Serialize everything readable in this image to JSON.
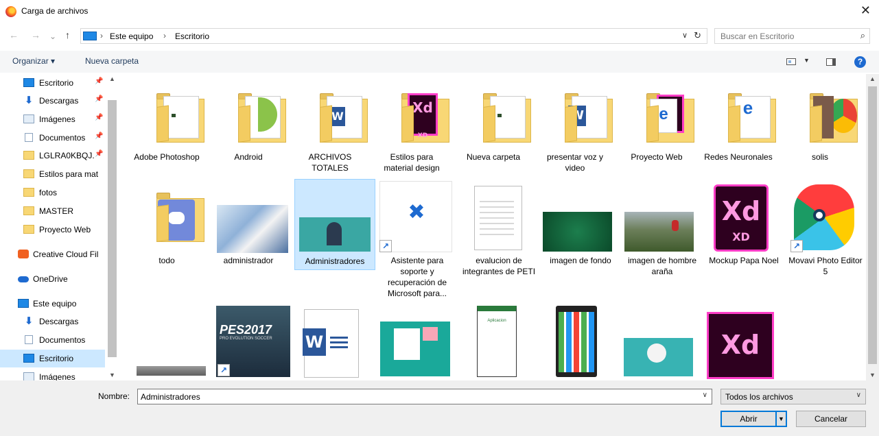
{
  "window": {
    "title": "Carga de archivos",
    "close_glyph": "✕"
  },
  "nav": {
    "back": "←",
    "forward": "→",
    "up": "↑"
  },
  "breadcrumb": {
    "items": [
      "Este equipo",
      "Escritorio"
    ],
    "separator": "›"
  },
  "search": {
    "placeholder": "Buscar en Escritorio"
  },
  "toolbar": {
    "organize_label": "Organizar ▾",
    "new_folder_label": "Nueva carpeta",
    "help_label": "?"
  },
  "sidebar": {
    "items": [
      {
        "label": "Escritorio",
        "icon": "desktop-icon",
        "pinned": true
      },
      {
        "label": "Descargas",
        "icon": "download-icon",
        "pinned": true
      },
      {
        "label": "Imágenes",
        "icon": "pictures-icon",
        "pinned": true
      },
      {
        "label": "Documentos",
        "icon": "documents-icon",
        "pinned": true
      },
      {
        "label": "LGLRA0KBQJ.",
        "icon": "folder-icon",
        "pinned": true
      },
      {
        "label": "Estilos  para mat",
        "icon": "folder-icon",
        "pinned": false
      },
      {
        "label": "fotos",
        "icon": "folder-icon",
        "pinned": false
      },
      {
        "label": "MASTER",
        "icon": "folder-icon",
        "pinned": false
      },
      {
        "label": "Proyecto Web",
        "icon": "folder-icon",
        "pinned": false
      },
      {
        "label": "Creative Cloud Fil",
        "icon": "creative-cloud-icon",
        "pinned": false
      },
      {
        "label": "OneDrive",
        "icon": "onedrive-icon",
        "pinned": false
      },
      {
        "label": "Este equipo",
        "icon": "this-pc-icon",
        "pinned": false
      },
      {
        "label": "Descargas",
        "icon": "download-icon",
        "pinned": false
      },
      {
        "label": "Documentos",
        "icon": "documents-icon",
        "pinned": false
      },
      {
        "label": "Escritorio",
        "icon": "desktop-icon",
        "pinned": false,
        "selected": true
      },
      {
        "label": "Imágenes",
        "icon": "pictures-icon",
        "pinned": false
      }
    ]
  },
  "files": {
    "row1": [
      {
        "label": "Adobe Photoshop",
        "type": "folder"
      },
      {
        "label": "Android",
        "type": "folder"
      },
      {
        "label": "ARCHIVOS TOTALES",
        "type": "folder"
      },
      {
        "label": "Estilos  para material design",
        "type": "folder"
      },
      {
        "label": "Nueva carpeta",
        "type": "folder"
      },
      {
        "label": "presentar voz y video",
        "type": "folder"
      },
      {
        "label": "Proyecto Web",
        "type": "folder"
      },
      {
        "label": "Redes Neuronales",
        "type": "folder"
      },
      {
        "label": "solis",
        "type": "folder"
      }
    ],
    "row2": [
      {
        "label": "todo",
        "type": "folder"
      },
      {
        "label": "administrador",
        "type": "image"
      },
      {
        "label": "Administradores",
        "type": "image",
        "selected": true
      },
      {
        "label": "Asistente para soporte y recuperación de Microsoft para...",
        "type": "shortcut"
      },
      {
        "label": "evalucion de integrantes de PETI",
        "type": "document"
      },
      {
        "label": "imagen de fondo",
        "type": "image"
      },
      {
        "label": "imagen de hombre araña",
        "type": "image"
      },
      {
        "label": "Mockup Papa Noel",
        "type": "xd"
      },
      {
        "label": "Movavi Photo Editor 5",
        "type": "shortcut"
      }
    ],
    "row3_icons": [
      "image",
      "image",
      "word",
      "image",
      "image",
      "image",
      "image",
      "xd"
    ],
    "row3_texts": {
      "pes_title": "PES2017",
      "pes_sub": "PRO EVOLUTION SOCCER",
      "app_title": "Aplicacion"
    }
  },
  "footer": {
    "name_label": "Nombre:",
    "name_value": "Administradores",
    "filter_value": "Todos los archivos",
    "open_label": "Abrir",
    "cancel_label": "Cancelar"
  },
  "colors": {
    "selection": "#cce8ff",
    "accent": "#0078d7",
    "folder": "#f8d775",
    "xd": "#ff3dc7"
  }
}
